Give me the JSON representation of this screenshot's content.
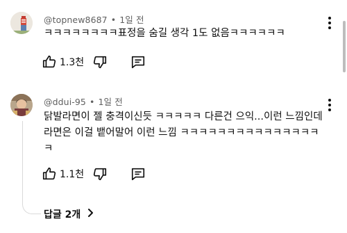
{
  "comments": [
    {
      "author": "@topnew8687",
      "time": "1일 전",
      "text": "ㅋㅋㅋㅋㅋㅋㅋㅋ표정을 숨길 생각 1도 없음ㅋㅋㅋㅋㅋㅋ",
      "likes": "1.3천"
    },
    {
      "author": "@ddui-95",
      "time": "1일 전",
      "text": "닭발라면이 젤 충격이신듯 ㅋㅋㅋㅋㅋ 다른건 으익...이런 느낌인데\n라면은 이걸 뱉어말어 이런 느낌 ㅋㅋㅋㅋㅋㅋㅋㅋㅋㅋㅋㅋㅋㅋㅋ\nㅋ",
      "likes": "1.1천",
      "replies_label": "답글 2개"
    }
  ],
  "separator": "•",
  "icons": {
    "like": "thumbs-up-icon",
    "dislike": "thumbs-down-icon",
    "reply": "comment-bubble-icon",
    "more": "more-vertical-icon",
    "expand": "chevron-right-icon"
  },
  "colors": {
    "text": "#0f0f0f",
    "secondary": "#606060",
    "thread_line": "#d9d9d9"
  }
}
